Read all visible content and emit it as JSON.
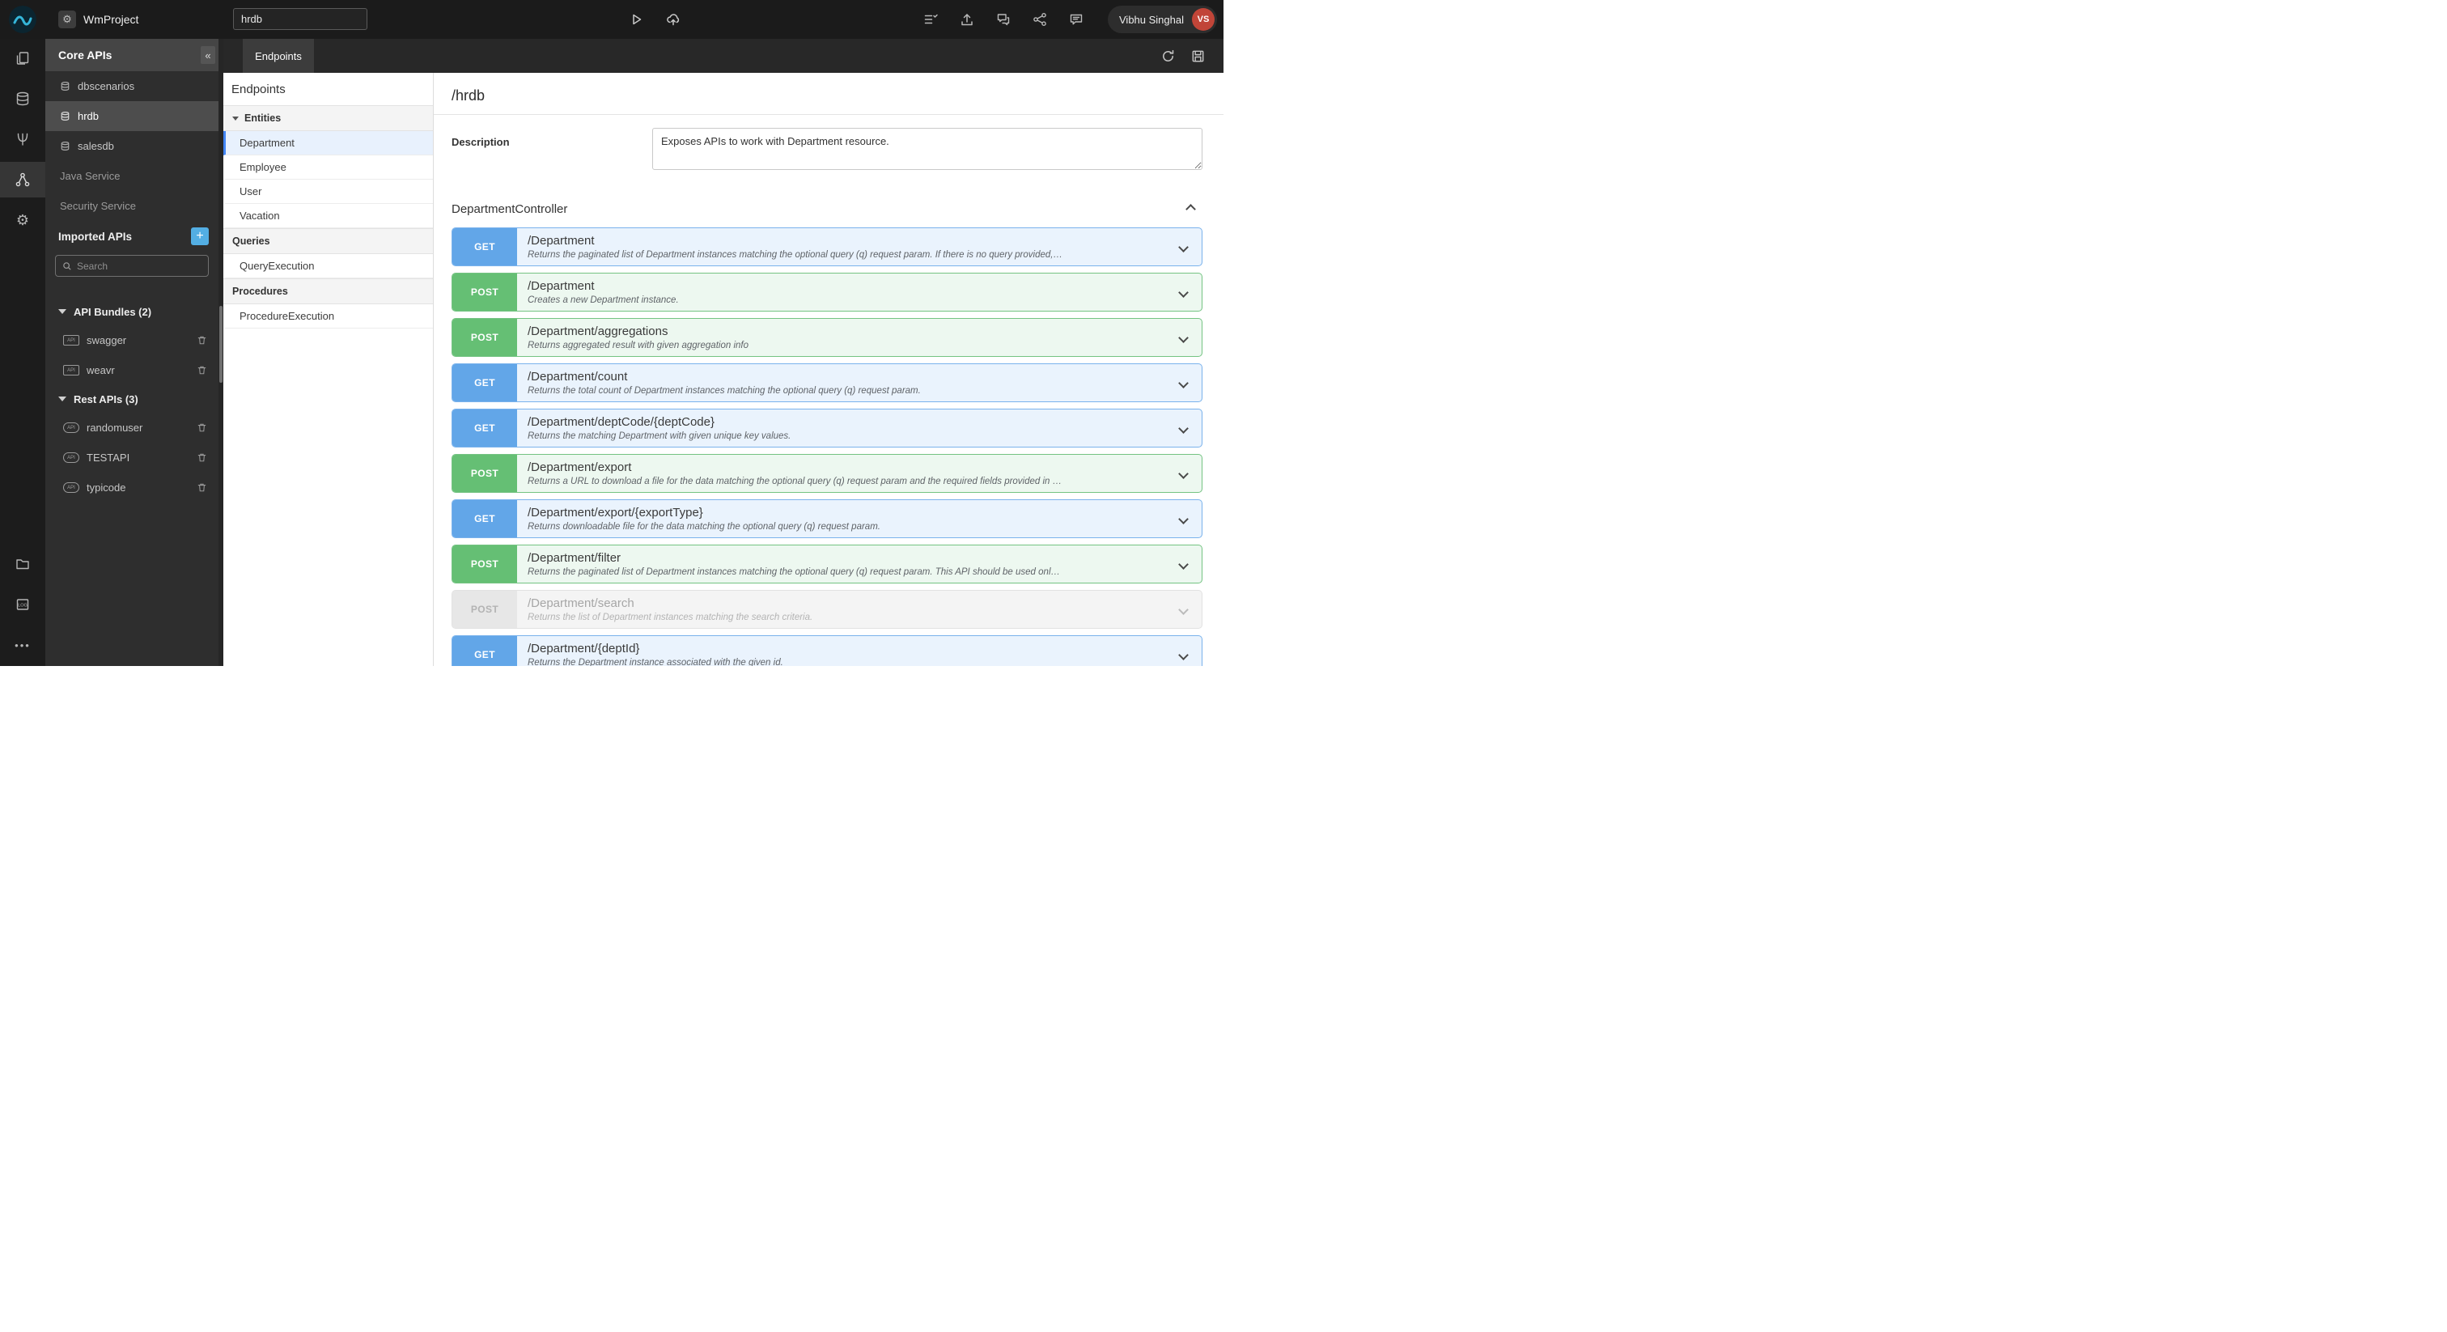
{
  "topbar": {
    "project_name": "WmProject",
    "search_value": "hrdb",
    "user_name": "Vibhu Singhal",
    "user_initials": "VS"
  },
  "icons": {
    "gear": "⚙",
    "more": "•••",
    "collapse": "«",
    "plus": "+",
    "api_badge": "API",
    "log_label": "LOG"
  },
  "sidebar": {
    "title": "Core APIs",
    "core_items": [
      "dbscenarios",
      "hrdb",
      "salesdb",
      "Java Service",
      "Security Service"
    ],
    "imported_title": "Imported APIs",
    "search_placeholder": "Search",
    "bundles_label": "API Bundles (2)",
    "bundles": [
      "swagger",
      "weavr"
    ],
    "rest_label": "Rest APIs (3)",
    "rest": [
      "randomuser",
      "TESTAPI",
      "typicode"
    ]
  },
  "tabstrip": {
    "active_tab": "Endpoints"
  },
  "tree": {
    "title": "Endpoints",
    "entities_label": "Entities",
    "entities": [
      "Department",
      "Employee",
      "User",
      "Vacation"
    ],
    "queries_label": "Queries",
    "queries": [
      "QueryExecution"
    ],
    "procedures_label": "Procedures",
    "procedures": [
      "ProcedureExecution"
    ]
  },
  "detail": {
    "title": "/hrdb",
    "description_label": "Description",
    "description_value": "Exposes APIs to work with Department resource.",
    "controller": "DepartmentController",
    "endpoints": [
      {
        "method": "GET",
        "path": "/Department",
        "desc": "Returns the paginated list of Department instances matching the optional query (q) request param. If there is no query provided,…",
        "state": "normal"
      },
      {
        "method": "POST",
        "path": "/Department",
        "desc": "Creates a new Department instance.",
        "state": "normal"
      },
      {
        "method": "POST",
        "path": "/Department/aggregations",
        "desc": "Returns aggregated result with given aggregation info",
        "state": "normal"
      },
      {
        "method": "GET",
        "path": "/Department/count",
        "desc": "Returns the total count of Department instances matching the optional query (q) request param.",
        "state": "normal"
      },
      {
        "method": "GET",
        "path": "/Department/deptCode/{deptCode}",
        "desc": "Returns the matching Department with given unique key values.",
        "state": "normal"
      },
      {
        "method": "POST",
        "path": "/Department/export",
        "desc": "Returns a URL to download a file for the data matching the optional query (q) request param and the required fields provided in …",
        "state": "normal"
      },
      {
        "method": "GET",
        "path": "/Department/export/{exportType}",
        "desc": "Returns downloadable file for the data matching the optional query (q) request param.",
        "state": "normal"
      },
      {
        "method": "POST",
        "path": "/Department/filter",
        "desc": "Returns the paginated list of Department instances matching the optional query (q) request param. This API should be used onl…",
        "state": "normal"
      },
      {
        "method": "POST",
        "path": "/Department/search",
        "desc": "Returns the list of Department instances matching the search criteria.",
        "state": "disabled"
      },
      {
        "method": "GET",
        "path": "/Department/{deptId}",
        "desc": "Returns the Department instance associated with the given id.",
        "state": "normal"
      }
    ]
  },
  "colors": {
    "get_badge": "#62a6e8",
    "get_bg": "#eaf3fd",
    "post_badge": "#65bf74",
    "post_bg": "#edf8f0",
    "disabled_bg": "#f4f4f4",
    "selected_accent": "#4285f4",
    "avatar_bg": "#c14538",
    "topbar_bg": "#1b1b1b",
    "sidebar_bg": "#2e2e2e"
  }
}
